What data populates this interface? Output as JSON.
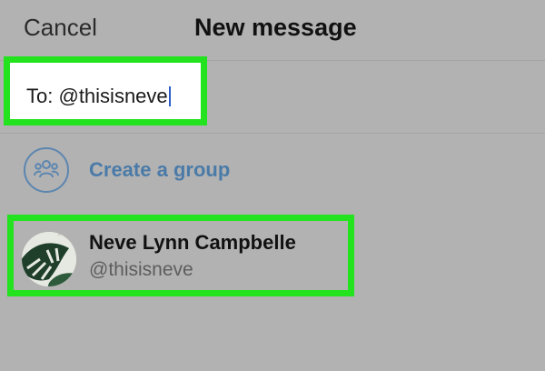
{
  "header": {
    "cancel_label": "Cancel",
    "title": "New message"
  },
  "recipient": {
    "prefix": "To:",
    "value": "@thisisneve"
  },
  "create_group": {
    "label": "Create a group",
    "icon": "people-group-icon"
  },
  "result": {
    "name": "Neve Lynn Campbelle",
    "handle": "@thisisneve",
    "avatar": "avatar-monstera-leaf"
  },
  "colors": {
    "background": "#b3b2b2",
    "highlight": "#22e31d",
    "link_blue": "#4a7ba8",
    "caret_blue": "#2b5dc8"
  }
}
